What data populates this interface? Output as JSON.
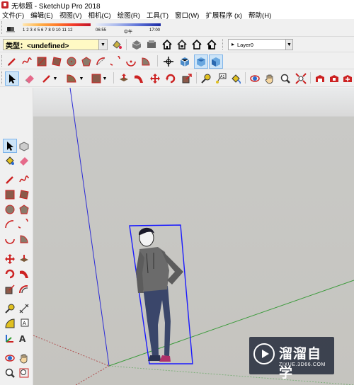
{
  "window": {
    "title": "无标题 - SketchUp Pro 2018"
  },
  "menu": [
    "文件(F)",
    "编辑(E)",
    "视图(V)",
    "相机(C)",
    "绘图(R)",
    "工具(T)",
    "窗口(W)",
    "扩展程序 (x)",
    "帮助(H)"
  ],
  "shadow_toolbar": {
    "months": "1 2 3 4 5 6 7 8 9 10 11 12",
    "time_start": "06:55",
    "time_mid": "中午",
    "time_end": "17:00"
  },
  "type_select": {
    "value": "类型：<undefined>"
  },
  "layer_select": {
    "value": "Layer0"
  },
  "watermark": {
    "brand": "溜溜自学",
    "url": "ZIXUE.3D66.COM"
  },
  "colors": {
    "red_axis": "#c03030",
    "green_axis": "#3a9a3a",
    "blue_axis": "#2b2bd6",
    "selection": "#1a1aff"
  }
}
